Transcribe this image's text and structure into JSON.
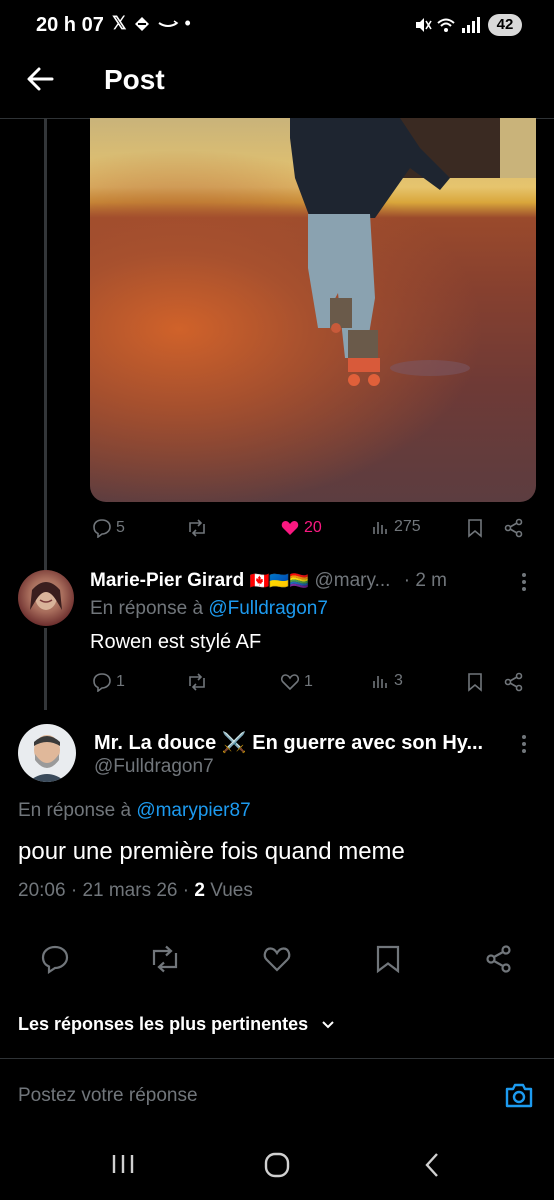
{
  "status": {
    "time": "20 h 07",
    "battery": "42"
  },
  "header": {
    "title": "Post"
  },
  "parent_post": {
    "stats": {
      "replies": "5",
      "likes": "20",
      "views": "275"
    }
  },
  "reply1": {
    "name": "Marie-Pier Girard",
    "flags": "🇨🇦🇺🇦🏳️‍🌈",
    "handle": "@mary...",
    "time": "· 2 m",
    "reply_prefix": "En réponse à",
    "reply_to": "@Fulldragon7",
    "text": "Rowen est stylé AF",
    "stats": {
      "replies": "1",
      "likes": "1",
      "views": "3"
    }
  },
  "main_post": {
    "name": "Mr. La douce",
    "name_emoji": "⚔️",
    "name_suffix": "En guerre avec son Hy...",
    "handle": "@Fulldragon7",
    "reply_prefix": "En réponse à",
    "reply_to": "@marypier87",
    "text": "pour une première fois quand meme",
    "time": "20:06",
    "date": "21 mars 26",
    "views_count": "2",
    "views_label": "Vues"
  },
  "sort": {
    "label": "Les réponses les plus pertinentes"
  },
  "reply_box": {
    "placeholder": "Postez votre réponse"
  },
  "colors": {
    "accent": "#1d9bf0",
    "like": "#f91880",
    "muted": "#71767b"
  }
}
